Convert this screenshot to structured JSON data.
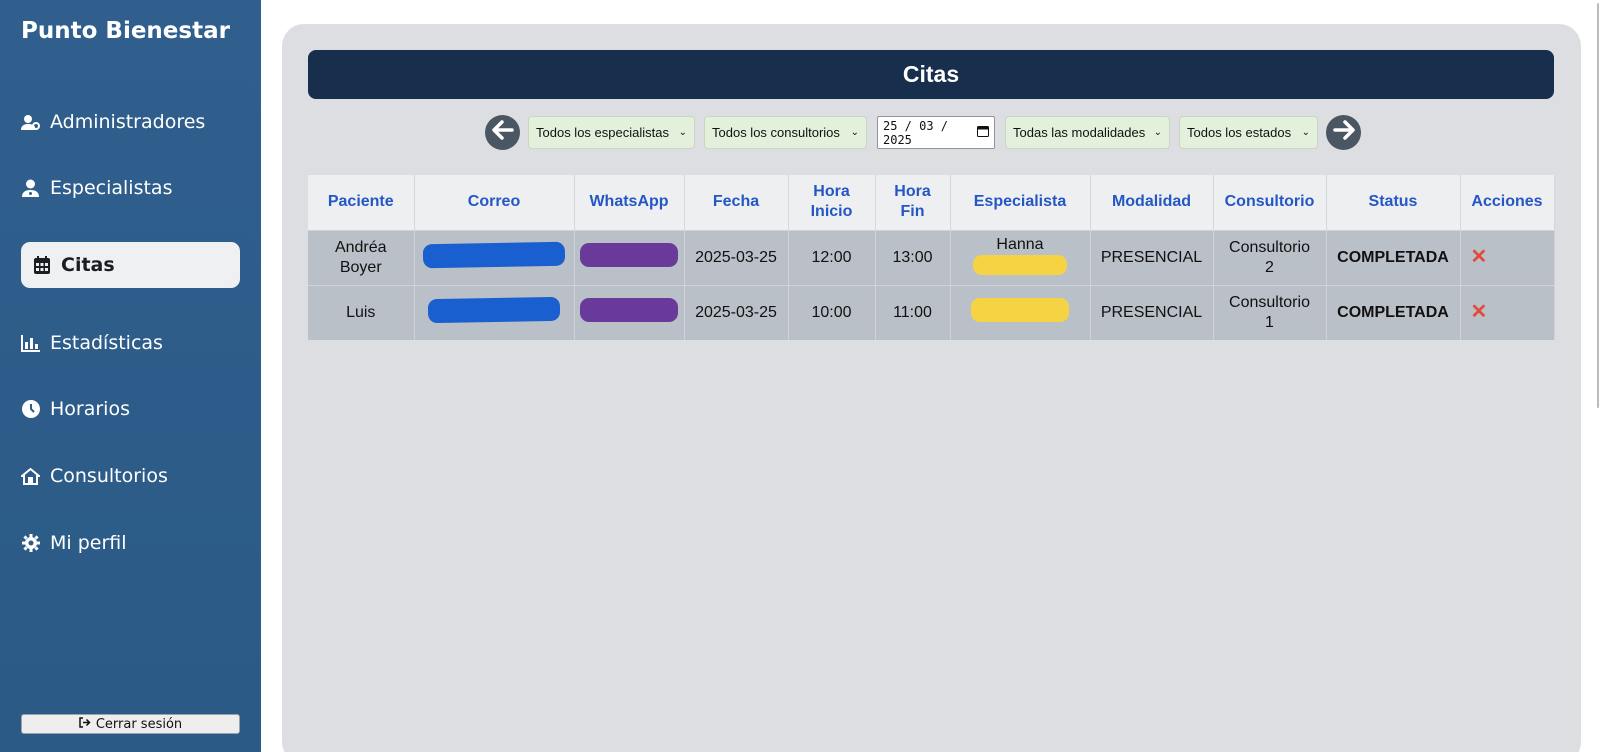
{
  "sidebar": {
    "brand": "Punto Bienestar",
    "items": [
      {
        "label": "Administradores",
        "icon": "user-gear-icon"
      },
      {
        "label": "Especialistas",
        "icon": "user-doctor-icon"
      },
      {
        "label": "Citas",
        "icon": "calendar-icon",
        "active": true
      },
      {
        "label": "Estadísticas",
        "icon": "bar-chart-icon"
      },
      {
        "label": "Horarios",
        "icon": "clock-icon"
      },
      {
        "label": "Consultorios",
        "icon": "house-icon"
      },
      {
        "label": "Mi perfil",
        "icon": "gear-icon"
      }
    ],
    "logout_label": "Cerrar sesión"
  },
  "main": {
    "title": "Citas",
    "filters": {
      "specialist": "Todos los especialistas",
      "office": "Todos los consultorios",
      "date": "25 / 03 / 2025",
      "modality": "Todas las modalidades",
      "status": "Todos los estados"
    },
    "table": {
      "headers": [
        "Paciente",
        "Correo",
        "WhatsApp",
        "Fecha",
        "Hora Inicio",
        "Hora Fin",
        "Especialista",
        "Modalidad",
        "Consultorio",
        "Status",
        "Acciones"
      ],
      "rows": [
        {
          "paciente": "Andréa Boyer",
          "correo": "",
          "whatsapp": "",
          "fecha": "2025-03-25",
          "hora_inicio": "12:00",
          "hora_fin": "13:00",
          "especialista": "Hanna",
          "modalidad": "PRESENCIAL",
          "consultorio": "Consultorio 2",
          "status": "COMPLETADA",
          "accion": "✕"
        },
        {
          "paciente": "Luis",
          "correo": "",
          "whatsapp": "",
          "fecha": "2025-03-25",
          "hora_inicio": "10:00",
          "hora_fin": "11:00",
          "especialista": "",
          "modalidad": "PRESENCIAL",
          "consultorio": "Consultorio 1",
          "status": "COMPLETADA",
          "accion": "✕"
        }
      ]
    }
  },
  "colors": {
    "sidebar": "#2d5c89",
    "title_bar": "#182e4d",
    "header_text": "#2457c5",
    "status_done": "#3aa33a",
    "delete": "#e04b3c"
  }
}
